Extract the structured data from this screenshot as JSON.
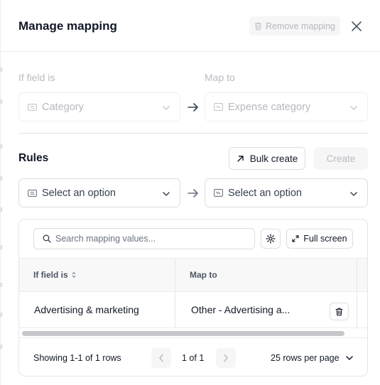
{
  "header": {
    "title": "Manage mapping",
    "remove_label": "Remove mapping"
  },
  "mapping": {
    "if_field_label": "If field is",
    "map_to_label": "Map to",
    "if_field_value": "Category",
    "map_to_value": "Expense category"
  },
  "rules": {
    "title": "Rules",
    "bulk_create_label": "Bulk create",
    "create_label": "Create",
    "left_select_placeholder": "Select an option",
    "right_select_placeholder": "Select an option"
  },
  "table": {
    "search_placeholder": "Search mapping values...",
    "full_screen_label": "Full screen",
    "columns": [
      "If field is",
      "Map to"
    ],
    "rows": [
      {
        "if_field": "Advertising & marketing",
        "map_to": "Other - Advertising a..."
      }
    ],
    "showing": "Showing 1-1 of 1 rows",
    "page": "1 of 1",
    "rows_per_page": "25 rows per page"
  },
  "icons": {
    "close": "close-icon",
    "trash": "trash-icon",
    "arrow_right": "arrow-right-icon",
    "chevron_down": "chevron-down-icon",
    "search": "search-icon",
    "gear": "gear-icon",
    "expand": "expand-icon",
    "arrow_up_right": "arrow-up-right-icon",
    "sort": "sort-icon",
    "chevron_left": "chevron-left-icon",
    "chevron_right": "chevron-right-icon"
  },
  "colors": {
    "text": "#111827",
    "muted": "#b6b8be",
    "border": "#dcdde1"
  }
}
